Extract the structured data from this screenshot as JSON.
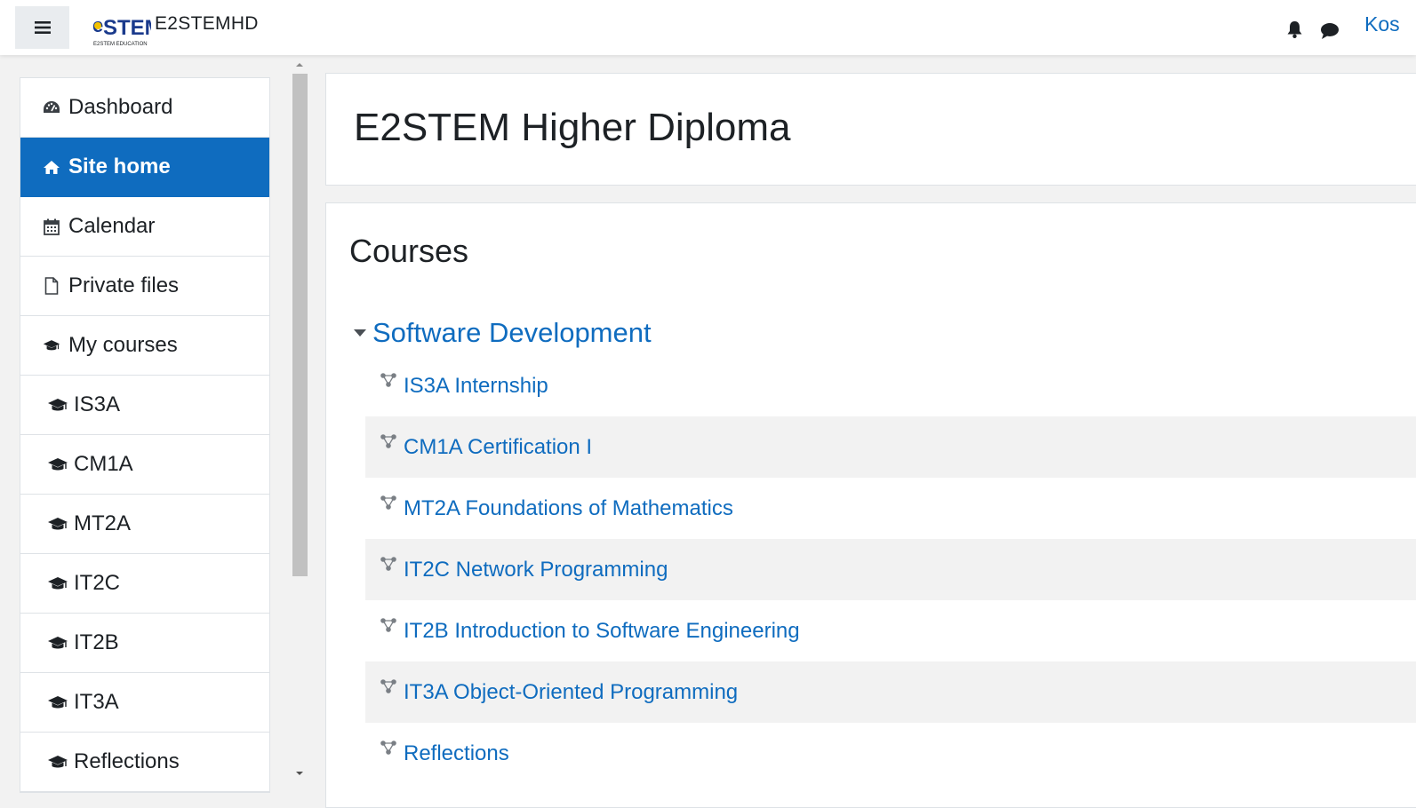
{
  "navbar": {
    "menu_icon": "hamburger-menu-icon",
    "logo_text": "eSTEM",
    "logo_subtext": "E2STEM EDUCATION",
    "site_name": "E2STEMHD",
    "notification_icon": "bell-icon",
    "messages_icon": "chat-bubble-icon",
    "user_name": "Kos"
  },
  "drawer": {
    "items": [
      {
        "label": "Dashboard",
        "icon": "dashboard-icon"
      },
      {
        "label": "Site home",
        "icon": "home-icon",
        "active": true
      },
      {
        "label": "Calendar",
        "icon": "calendar-icon"
      },
      {
        "label": "Private files",
        "icon": "file-icon"
      },
      {
        "label": "My courses",
        "icon": "graduation-cap-icon"
      },
      {
        "label": "IS3A",
        "icon": "graduation-cap-icon"
      },
      {
        "label": "CM1A",
        "icon": "graduation-cap-icon"
      },
      {
        "label": "MT2A",
        "icon": "graduation-cap-icon"
      },
      {
        "label": "IT2C",
        "icon": "graduation-cap-icon"
      },
      {
        "label": "IT2B",
        "icon": "graduation-cap-icon"
      },
      {
        "label": "IT3A",
        "icon": "graduation-cap-icon"
      },
      {
        "label": "Reflections",
        "icon": "graduation-cap-icon"
      }
    ]
  },
  "main": {
    "page_title": "E2STEM Higher Diploma",
    "courses_heading": "Courses",
    "category": {
      "name": "Software Development",
      "expanded": true,
      "courses": [
        "IS3A Internship",
        "CM1A Certification I",
        "MT2A Foundations of Mathematics",
        "IT2C Network Programming",
        "IT2B Introduction to Software Engineering",
        "IT3A Object-Oriented Programming",
        "Reflections"
      ]
    }
  },
  "colors": {
    "accent": "#0f6cbf",
    "background": "#f2f2f2",
    "row_alt": "#f2f2f2"
  }
}
